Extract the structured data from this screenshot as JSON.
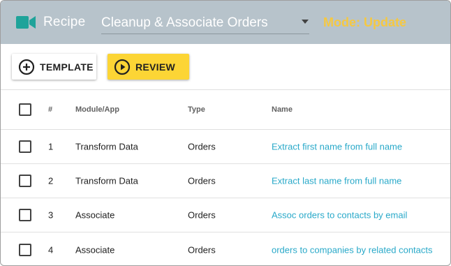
{
  "header": {
    "title": "Recipe",
    "recipe_select": {
      "value": "Cleanup & Associate Orders"
    },
    "mode": "Mode: Update"
  },
  "toolbar": {
    "template_label": "TEMPLATE",
    "review_label": "REVIEW"
  },
  "table": {
    "columns": [
      "#",
      "Module/App",
      "Type",
      "Name"
    ],
    "rows": [
      {
        "num": "1",
        "module": "Transform Data",
        "type": "Orders",
        "name": "Extract first name from full name"
      },
      {
        "num": "2",
        "module": "Transform Data",
        "type": "Orders",
        "name": "Extract last name from full name"
      },
      {
        "num": "3",
        "module": "Associate",
        "type": "Orders",
        "name": "Assoc orders to contacts by email"
      },
      {
        "num": "4",
        "module": "Associate",
        "type": "Orders",
        "name": "orders to companies by related contacts"
      }
    ]
  },
  "colors": {
    "header_bg": "#b7c3cb",
    "accent_teal": "#1fa39a",
    "mode_yellow": "#f5c842",
    "review_button": "#fcd535",
    "link": "#29a9c9"
  },
  "icons": {
    "recipe": "video-camera-icon",
    "select_caret": "caret-down-icon",
    "template": "plus-circle-icon",
    "review": "play-circle-icon",
    "row_check": "checkbox-unchecked-icon"
  }
}
